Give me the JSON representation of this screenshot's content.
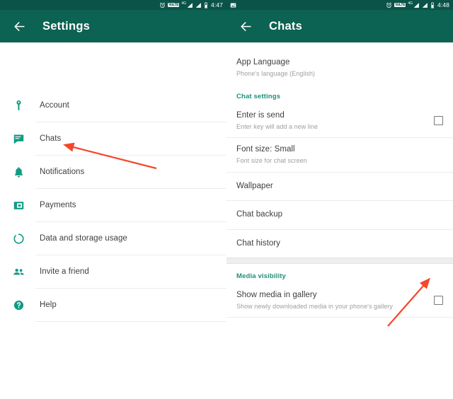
{
  "colors": {
    "toolbar": "#0c6253",
    "statusbar": "#0b5349",
    "accent_teal": "#1a8f7a",
    "icon_teal": "#0f9b84",
    "arrow": "#f4472c",
    "text_primary": "#3c4043",
    "text_secondary": "#9e9e9e"
  },
  "left_panel": {
    "statusbar": {
      "time": "4:47",
      "icons": [
        "alarm-icon",
        "volte-icon",
        "signal-4g-icon",
        "signal-bars-icon",
        "battery-icon"
      ],
      "volte_label": "VoLTE",
      "network_label": "4G"
    },
    "toolbar": {
      "back_icon": "back-arrow-icon",
      "title": "Settings"
    },
    "items": [
      {
        "label": "Account",
        "icon": "key-icon"
      },
      {
        "label": "Chats",
        "icon": "chat-icon"
      },
      {
        "label": "Notifications",
        "icon": "bell-icon"
      },
      {
        "label": "Payments",
        "icon": "payments-card-icon"
      },
      {
        "label": "Data and storage usage",
        "icon": "data-usage-icon"
      },
      {
        "label": "Invite a friend",
        "icon": "people-icon"
      },
      {
        "label": "Help",
        "icon": "help-circle-icon"
      }
    ]
  },
  "right_panel": {
    "statusbar": {
      "time": "4:48",
      "notification_icon": "screenshot-image-icon",
      "icons": [
        "alarm-icon",
        "volte-icon",
        "signal-4g-icon",
        "signal-bars-icon",
        "battery-icon"
      ],
      "volte_label": "VoLTE",
      "network_label": "4G"
    },
    "toolbar": {
      "back_icon": "back-arrow-icon",
      "title": "Chats"
    },
    "app_language": {
      "title": "App Language",
      "subtitle": "Phone's language (English)"
    },
    "chat_settings_header": "Chat settings",
    "enter_is_send": {
      "title": "Enter is send",
      "subtitle": "Enter key will add a new line",
      "checked": false
    },
    "font_size": {
      "title": "Font size: Small",
      "subtitle": "Font size for chat screen"
    },
    "simple_rows": [
      {
        "title": "Wallpaper"
      },
      {
        "title": "Chat backup"
      },
      {
        "title": "Chat history"
      }
    ],
    "media_visibility_header": "Media visibility",
    "show_media": {
      "title": "Show media in gallery",
      "subtitle": "Show newly downloaded media in your phone's gallery",
      "checked": false
    }
  },
  "annotations": [
    {
      "name": "arrow-to-chats",
      "target": "Chats settings item"
    },
    {
      "name": "arrow-to-show-media-checkbox",
      "target": "Show media in gallery checkbox"
    }
  ]
}
